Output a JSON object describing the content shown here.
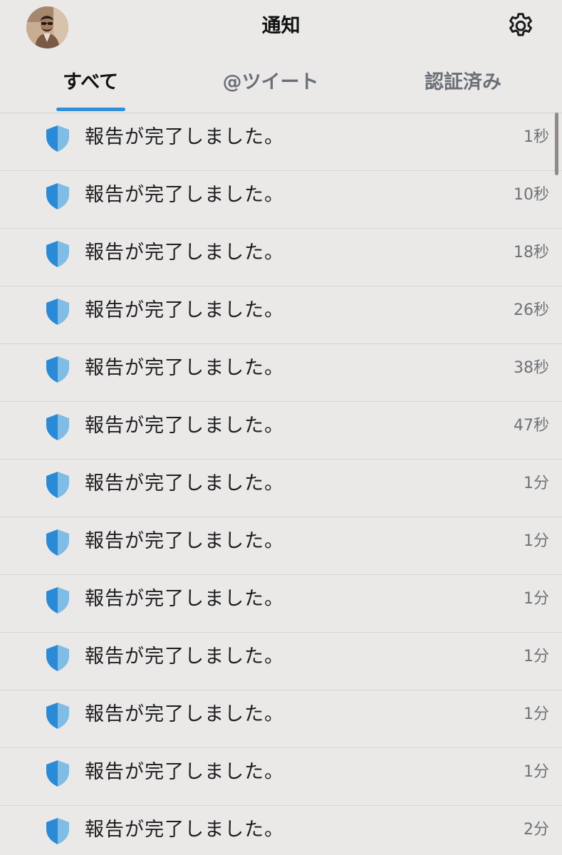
{
  "header": {
    "title": "通知",
    "avatar_icon": "user-avatar",
    "settings_icon": "gear-icon"
  },
  "tabs": [
    {
      "label": "すべて",
      "active": true
    },
    {
      "label": "@ツイート",
      "active": false
    },
    {
      "label": "認証済み",
      "active": false
    }
  ],
  "colors": {
    "accent": "#2f8fd8",
    "shield_dark": "#2b8ad6",
    "shield_light": "#7fbde6",
    "background": "#ebe9e8"
  },
  "notifications": [
    {
      "icon": "shield-icon",
      "message": "報告が完了しました。",
      "time": "1秒"
    },
    {
      "icon": "shield-icon",
      "message": "報告が完了しました。",
      "time": "10秒"
    },
    {
      "icon": "shield-icon",
      "message": "報告が完了しました。",
      "time": "18秒"
    },
    {
      "icon": "shield-icon",
      "message": "報告が完了しました。",
      "time": "26秒"
    },
    {
      "icon": "shield-icon",
      "message": "報告が完了しました。",
      "time": "38秒"
    },
    {
      "icon": "shield-icon",
      "message": "報告が完了しました。",
      "time": "47秒"
    },
    {
      "icon": "shield-icon",
      "message": "報告が完了しました。",
      "time": "1分"
    },
    {
      "icon": "shield-icon",
      "message": "報告が完了しました。",
      "time": "1分"
    },
    {
      "icon": "shield-icon",
      "message": "報告が完了しました。",
      "time": "1分"
    },
    {
      "icon": "shield-icon",
      "message": "報告が完了しました。",
      "time": "1分"
    },
    {
      "icon": "shield-icon",
      "message": "報告が完了しました。",
      "time": "1分"
    },
    {
      "icon": "shield-icon",
      "message": "報告が完了しました。",
      "time": "1分"
    },
    {
      "icon": "shield-icon",
      "message": "報告が完了しました。",
      "time": "2分"
    }
  ]
}
